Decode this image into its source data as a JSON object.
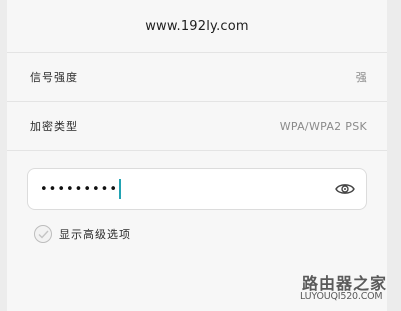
{
  "header": {
    "title": "www.192ly.com"
  },
  "rows": [
    {
      "label": "信号强度",
      "value": "强"
    },
    {
      "label": "加密类型",
      "value": "WPA/WPA2 PSK"
    }
  ],
  "password": {
    "value": "•••••••••",
    "icon": "eye-icon"
  },
  "advanced": {
    "label": "显示高级选项",
    "checked": false
  },
  "watermark": {
    "name": "路由器之家",
    "url": "LUYOUQI520.COM"
  }
}
